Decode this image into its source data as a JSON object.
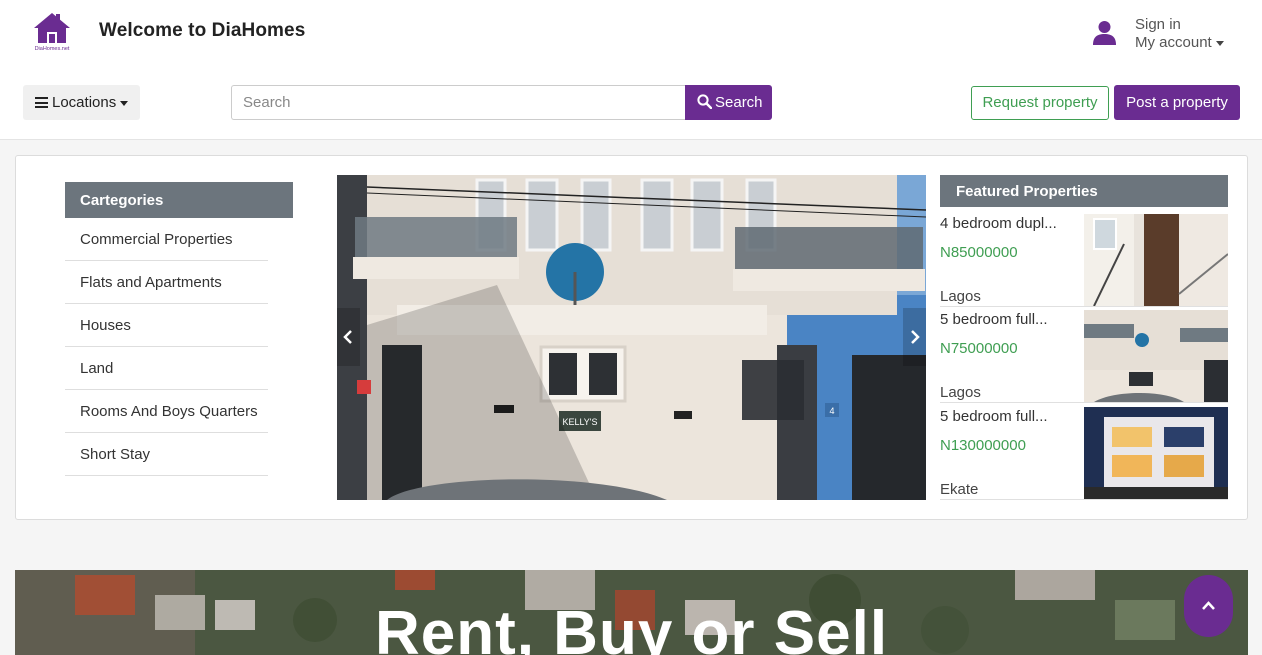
{
  "header": {
    "title": "Welcome to DiaHomes",
    "logo_text": "DiaHomes.net",
    "sign_in_label": "Sign in",
    "account_label": "My account"
  },
  "toolbar": {
    "locations_label": "Locations",
    "search_placeholder": "Search",
    "search_button_label": "Search",
    "request_button_label": "Request property",
    "post_button_label": "Post a property"
  },
  "categories": {
    "title": "Cartegories",
    "items": [
      "Commercial Properties",
      "Flats and Apartments",
      "Houses",
      "Land",
      "Rooms And Boys Quarters",
      "Short Stay"
    ]
  },
  "carousel": {
    "sign_text": "KELLY'S",
    "house_number": "4"
  },
  "featured": {
    "title": "Featured Properties",
    "items": [
      {
        "title": "4 bedroom dupl...",
        "price": "N85000000",
        "location": "Lagos"
      },
      {
        "title": "5 bedroom full...",
        "price": "N75000000",
        "location": "Lagos"
      },
      {
        "title": "5 bedroom full...",
        "price": "N130000000",
        "location": "Ekate"
      }
    ]
  },
  "hero": {
    "title": "Rent, Buy or Sell"
  },
  "colors": {
    "brand_purple": "#6a2c91",
    "accent_green": "#3f9e52",
    "header_gray": "#6c757d"
  },
  "icons": [
    "logo-house-icon",
    "user-icon",
    "caret-down-icon",
    "hamburger-icon",
    "search-icon",
    "chevron-left-icon",
    "chevron-right-icon",
    "chevron-up-icon"
  ]
}
